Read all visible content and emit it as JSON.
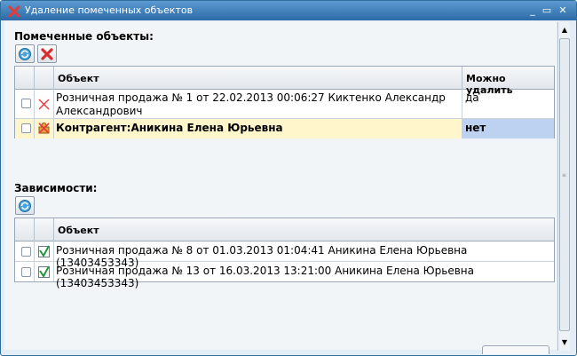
{
  "window": {
    "title": "Удаление помеченных объектов"
  },
  "marked": {
    "label": "Помеченные объекты:",
    "columns": {
      "object": "Объект",
      "can_delete": "Можно удалить"
    },
    "rows": [
      {
        "object": "Розничная продажа № 1 от 22.02.2013 00:06:27 Киктенко Александр Александрович",
        "can_delete": "да"
      },
      {
        "object": "Контрагент:Аникина Елена Юрьевна",
        "can_delete": "нет"
      }
    ]
  },
  "deps": {
    "label": "Зависимости:",
    "columns": {
      "object": "Объект"
    },
    "rows": [
      {
        "object": "Розничная продажа № 8 от 01.03.2013 01:04:41 Аникина Елена Юрьевна (13403453343)"
      },
      {
        "object": "Розничная продажа № 13 от 16.03.2013 13:21:00 Аникина Елена Юрьевна (13403453343)"
      }
    ]
  },
  "colors": {
    "titlebar": "#2c6ba7",
    "selected_row": "#fff6cc",
    "selected_cell": "#bcd2f0"
  }
}
